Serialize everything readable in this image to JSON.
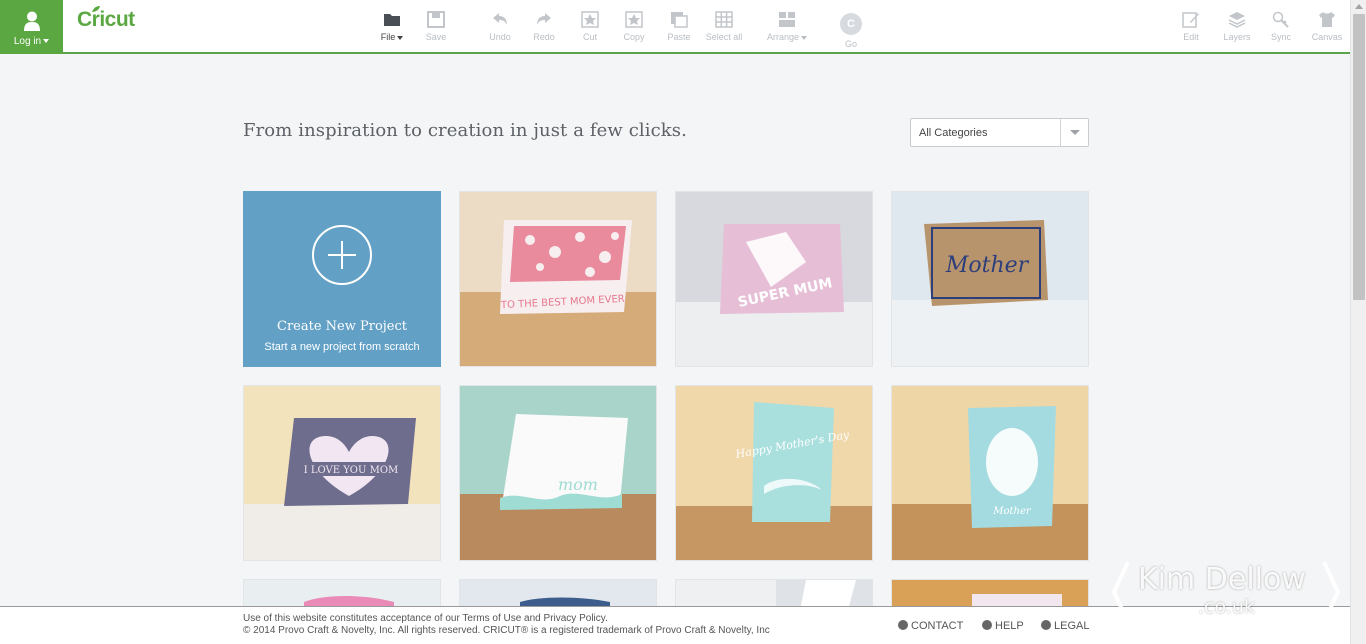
{
  "header": {
    "login_label": "Log in",
    "logo_text": "Cricut",
    "brand_color": "#5ba843",
    "tools": [
      {
        "label": "File",
        "icon": "folder-icon",
        "active": true,
        "dropdown": true
      },
      {
        "label": "Save",
        "icon": "save-icon"
      },
      {
        "label": "Undo",
        "icon": "undo-icon"
      },
      {
        "label": "Redo",
        "icon": "redo-icon"
      },
      {
        "label": "Cut",
        "icon": "cut-icon"
      },
      {
        "label": "Copy",
        "icon": "copy-icon"
      },
      {
        "label": "Paste",
        "icon": "paste-icon"
      },
      {
        "label": "Select all",
        "icon": "select-all-icon"
      },
      {
        "label": "Arrange",
        "icon": "arrange-icon",
        "dropdown": true
      },
      {
        "label": "Go",
        "icon": "go-icon",
        "glyph": "C"
      }
    ],
    "right_tools": [
      {
        "label": "Edit",
        "icon": "edit-icon"
      },
      {
        "label": "Layers",
        "icon": "layers-icon"
      },
      {
        "label": "Sync",
        "icon": "sync-icon"
      },
      {
        "label": "Canvas",
        "icon": "canvas-icon"
      }
    ]
  },
  "main": {
    "headline": "From inspiration to creation in just a few clicks.",
    "category_select": {
      "value": "All Categories"
    },
    "create_tile": {
      "title": "Create New Project",
      "subtitle": "Start a new project from scratch",
      "color": "#62a0c6"
    },
    "projects": [
      {
        "name": "to-the-best-mom-ever-card",
        "card_text": "TO THE BEST MOM EVER",
        "bg": "#ecdcc6",
        "card": "#f7eef0",
        "accent": "#e8788e"
      },
      {
        "name": "super-mum-card",
        "card_text": "SUPER MUM",
        "bg": "#dcdde2",
        "card": "#e6bfd7",
        "accent": "#ffffff"
      },
      {
        "name": "mother-lettering-card",
        "card_text": "Mother",
        "bg": "#dfe8ef",
        "card": "#b8946d",
        "accent": "#2d3f7a"
      },
      {
        "name": "i-love-you-mom-card",
        "card_text": "I LOVE YOU MOM",
        "bg": "#f3e3bd",
        "card": "#6f6d8d",
        "accent": "#f1e6f2"
      },
      {
        "name": "mom-card",
        "card_text": "mom",
        "bg": "#a9d4c9",
        "card": "#fafafa",
        "accent": "#9fdcd3"
      },
      {
        "name": "happy-mothers-day-card",
        "card_text": "Happy Mother's Day",
        "bg": "#f0d8aa",
        "card": "#a9e0de",
        "accent": "#ffffff"
      },
      {
        "name": "mother-silhouette-card",
        "card_text": "Mother",
        "bg": "#eed6a6",
        "card": "#a4dbe1",
        "accent": "#ffffff"
      }
    ],
    "partial_row_colors": [
      "#e9eef0",
      "#e3e8ee",
      "#eef0f2",
      "#d9a058"
    ]
  },
  "footer": {
    "line1": "Use of this website constitutes acceptance of our Terms of Use and Privacy Policy.",
    "line2": "© 2014 Provo Craft & Novelty, Inc. All rights reserved. CRICUT® is a registered trademark of Provo Craft & Novelty, Inc",
    "links": [
      {
        "label": "CONTACT",
        "icon": "chat-icon"
      },
      {
        "label": "HELP",
        "icon": "help-icon"
      },
      {
        "label": "LEGAL",
        "icon": "gear-icon"
      }
    ]
  },
  "watermark": {
    "name": "Kim Dellow",
    "domain": ".co.uk"
  }
}
